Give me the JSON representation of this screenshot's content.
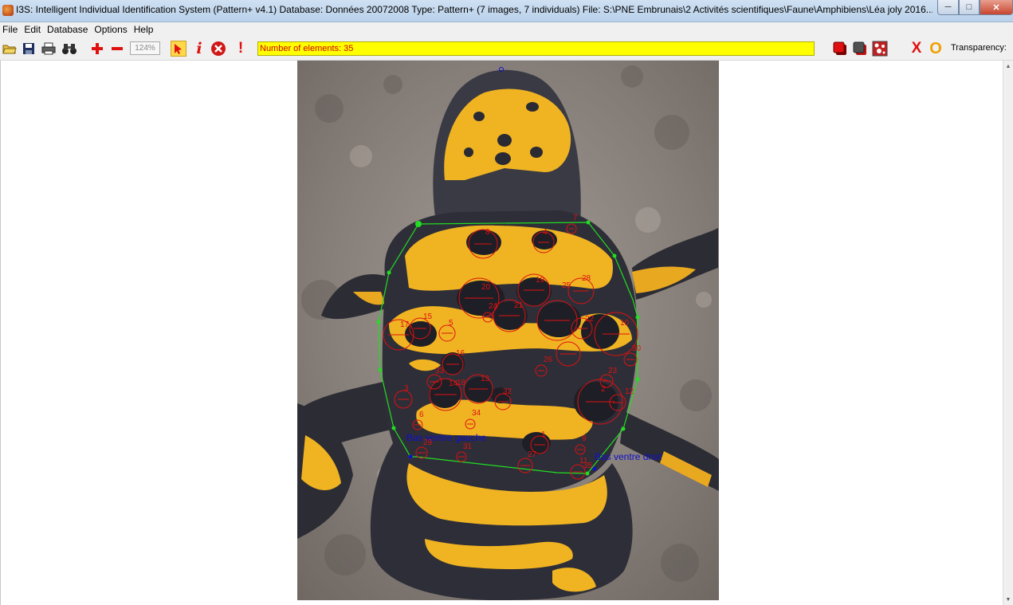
{
  "window": {
    "title": "I3S: Intelligent Individual Identification System (Pattern+ v4.1)  Database: Données 20072008  Type: Pattern+ (7 images, 7 individuals)  File: S:\\PNE Embrunais\\2 Activités scientifiques\\Faune\\Amphibiens\\Léa joly 2016...",
    "minimize_icon": "minimize-icon",
    "maximize_icon": "maximize-icon",
    "close_icon": "close-icon"
  },
  "menu": {
    "items": [
      {
        "label": "File"
      },
      {
        "label": "Edit"
      },
      {
        "label": "Database"
      },
      {
        "label": "Options"
      },
      {
        "label": "Help"
      }
    ]
  },
  "toolbar": {
    "zoom": "124%",
    "status_text": "Number of elements: 35",
    "transparency_label": "Transparency:",
    "icons": [
      "open-folder-icon",
      "save-icon",
      "print-icon",
      "binoculars-icon",
      "zoom-in-icon",
      "zoom-out-icon",
      "select-arrow-icon",
      "info-icon",
      "cancel-icon",
      "warning-icon",
      "red-square-icon",
      "dark-square-icon",
      "pattern-icon",
      "x-icon",
      "o-icon"
    ],
    "accent_red": "#e01010",
    "status_bg": "#ffff00"
  },
  "annotations": {
    "reference_left": "Bas ventre gauche",
    "reference_right": "Bas ventre droit",
    "spot_labels": [
      "7",
      "8",
      "4",
      "20",
      "19",
      "25",
      "28",
      "24",
      "21",
      "22",
      "10",
      "17",
      "15",
      "5",
      "16",
      "26",
      "30",
      "33",
      "14",
      "13",
      "23",
      "3",
      "2",
      "12",
      "34",
      "6",
      "1",
      "9",
      "29",
      "31",
      "27",
      "11",
      "32",
      "18",
      "35"
    ],
    "outline_color": "#22dd22",
    "spot_color": "#dd1111",
    "reference_color": "#1010cc"
  }
}
